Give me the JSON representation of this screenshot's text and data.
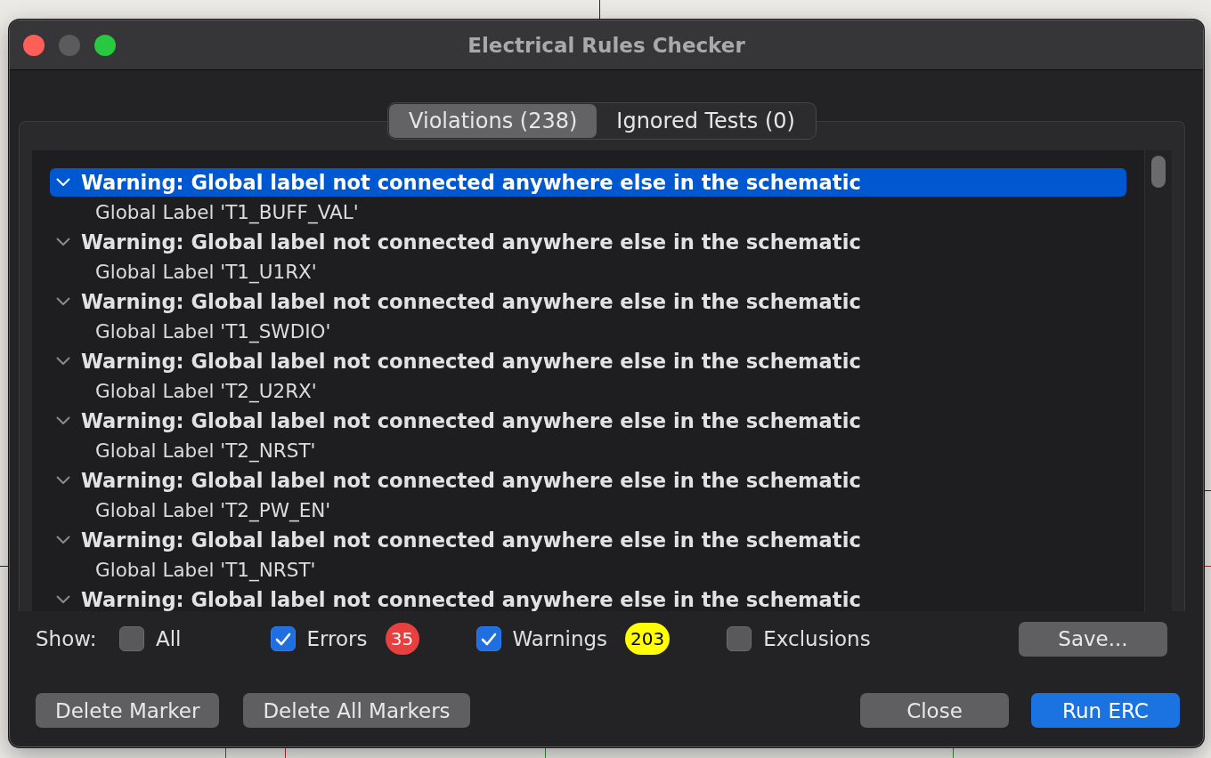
{
  "window": {
    "title": "Electrical Rules Checker"
  },
  "tabs": [
    {
      "label": "Violations (238)",
      "selected": true
    },
    {
      "label": "Ignored Tests (0)",
      "selected": false
    }
  ],
  "violations": [
    {
      "title": "Warning: Global label not connected anywhere else in the schematic",
      "expanded": true,
      "selected": true,
      "children": [
        {
          "label": "Global Label 'T1_BUFF_VAL'",
          "selected": false
        }
      ]
    },
    {
      "title": "Warning: Global label not connected anywhere else in the schematic",
      "expanded": true,
      "selected": false,
      "children": [
        {
          "label": "Global Label 'T1_U1RX'",
          "selected": false
        }
      ]
    },
    {
      "title": "Warning: Global label not connected anywhere else in the schematic",
      "expanded": true,
      "selected": false,
      "children": [
        {
          "label": "Global Label 'T1_SWDIO'",
          "selected": false
        }
      ]
    },
    {
      "title": "Warning: Global label not connected anywhere else in the schematic",
      "expanded": true,
      "selected": false,
      "children": [
        {
          "label": "Global Label 'T2_U2RX'",
          "selected": false
        }
      ]
    },
    {
      "title": "Warning: Global label not connected anywhere else in the schematic",
      "expanded": true,
      "selected": false,
      "children": [
        {
          "label": "Global Label 'T2_NRST'",
          "selected": false
        }
      ]
    },
    {
      "title": "Warning: Global label not connected anywhere else in the schematic",
      "expanded": true,
      "selected": false,
      "children": [
        {
          "label": "Global Label 'T2_PW_EN'",
          "selected": false
        }
      ]
    },
    {
      "title": "Warning: Global label not connected anywhere else in the schematic",
      "expanded": true,
      "selected": false,
      "children": [
        {
          "label": "Global Label 'T1_NRST'",
          "selected": false
        }
      ]
    },
    {
      "title": "Warning: Global label not connected anywhere else in the schematic",
      "expanded": true,
      "selected": false
    }
  ],
  "filters": {
    "label": "Show:",
    "options": [
      {
        "label": "All",
        "checked": false
      },
      {
        "label": "Errors",
        "checked": true,
        "count": "35",
        "color": "#e8403f"
      },
      {
        "label": "Warnings",
        "checked": true,
        "count": "203",
        "color": "#ffff00"
      },
      {
        "label": "Exclusions",
        "checked": false
      }
    ]
  },
  "save_button": {
    "label": "Save..."
  },
  "footer": {
    "left_buttons": [
      {
        "label": "Delete Marker"
      },
      {
        "label": "Delete All Markers"
      }
    ],
    "right_buttons": [
      {
        "label": "Close",
        "kind": "normal"
      },
      {
        "label": "Run ERC",
        "kind": "primary"
      }
    ]
  }
}
